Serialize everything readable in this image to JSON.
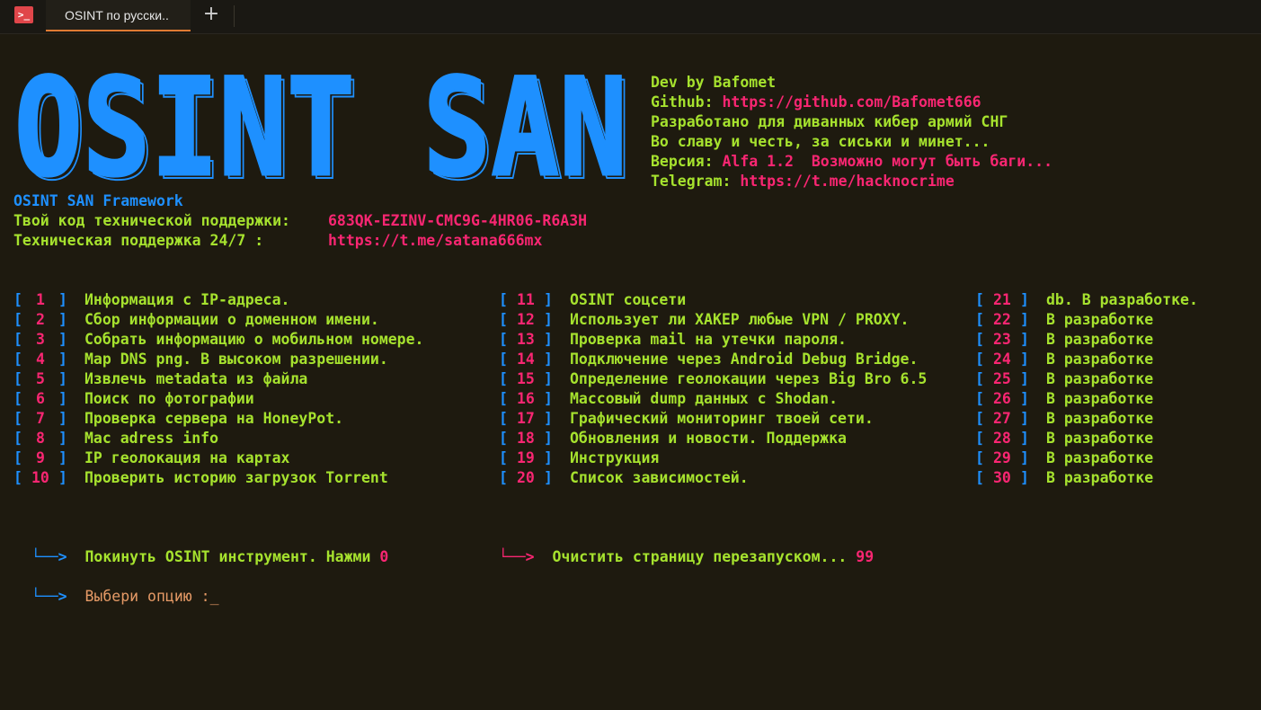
{
  "tab": {
    "app_icon": ">_",
    "title": "OSINT по русски..",
    "new_tab": "+"
  },
  "banner": {
    "text": "OSINT SAN"
  },
  "info": [
    {
      "label": "Dev by Bafomet",
      "value": ""
    },
    {
      "label": "Github: ",
      "value": "https://github.com/Bafomet666"
    },
    {
      "label": "Разработано для диванных кибер армий СНГ",
      "value": ""
    },
    {
      "label": "Во славу и честь, за сиськи и минет...",
      "value": ""
    },
    {
      "label": "Версия: ",
      "value": "Alfa 1.2  Возможно могут быть баги..."
    },
    {
      "label": "Telegram: ",
      "value": "https://t.me/hacknocrime"
    }
  ],
  "framework": {
    "title": "OSINT SAN Framework",
    "support_code_label": "Твой код технической поддержки:",
    "support_code": "683QK-EZINV-CMC9G-4HR06-R6A3H",
    "support_label": "Техническая поддержка 24/7 :",
    "support_link": "https://t.me/satana666mx"
  },
  "menu": {
    "col1": [
      {
        "num": "1",
        "text": "Информация с IP-адреса."
      },
      {
        "num": "2",
        "text": "Сбор информации о доменном имени."
      },
      {
        "num": "3",
        "text": "Собрать информацию о мобильном номере."
      },
      {
        "num": "4",
        "text": "Map DNS png. В высоком разрешении."
      },
      {
        "num": "5",
        "text": "Извлечь metadata из файла"
      },
      {
        "num": "6",
        "text": "Поиск по фотографии"
      },
      {
        "num": "7",
        "text": "Проверка сервера на HoneyPot."
      },
      {
        "num": "8",
        "text": "Mac adress info"
      },
      {
        "num": "9",
        "text": "IP геолокация на картах"
      },
      {
        "num": "10",
        "text": "Проверить историю загрузок Torrent"
      }
    ],
    "col2": [
      {
        "num": "11",
        "text": "OSINT соцсети"
      },
      {
        "num": "12",
        "text": "Использует ли ХАКЕР любые VPN / PROXY."
      },
      {
        "num": "13",
        "text": "Проверка mail на утечки пароля."
      },
      {
        "num": "14",
        "text": "Подключение через Android Debug Bridge."
      },
      {
        "num": "15",
        "text": "Определение геолокации через Big Bro 6.5"
      },
      {
        "num": "16",
        "text": "Массовый dump данных с Shodan."
      },
      {
        "num": "17",
        "text": "Графический мониторинг твоей сети."
      },
      {
        "num": "18",
        "text": "Обновления и новости. Поддержка"
      },
      {
        "num": "19",
        "text": "Инструкция"
      },
      {
        "num": "20",
        "text": "Список зависимостей."
      }
    ],
    "col3": [
      {
        "num": "21",
        "text": "db. В разработке."
      },
      {
        "num": "22",
        "text": "В разработке"
      },
      {
        "num": "23",
        "text": "В разработке"
      },
      {
        "num": "24",
        "text": "В разработке"
      },
      {
        "num": "25",
        "text": "В разработке"
      },
      {
        "num": "26",
        "text": "В разработке"
      },
      {
        "num": "27",
        "text": "В разработке"
      },
      {
        "num": "28",
        "text": "В разработке"
      },
      {
        "num": "29",
        "text": "В разработке"
      },
      {
        "num": "30",
        "text": "В разработке"
      }
    ]
  },
  "actions": {
    "arrow": "└──>",
    "exit_text": "Покинуть OSINT инструмент. Нажми ",
    "exit_key": "0",
    "clear_text": "Очистить страницу перезапуском... ",
    "clear_key": "99"
  },
  "prompt": {
    "text": "Выбери опцию :",
    "cursor": "_"
  },
  "colors": {
    "background": "#1e1a0f",
    "green": "#a6e22e",
    "pink": "#f92672",
    "blue": "#1e90ff",
    "orange": "#e59a66"
  }
}
